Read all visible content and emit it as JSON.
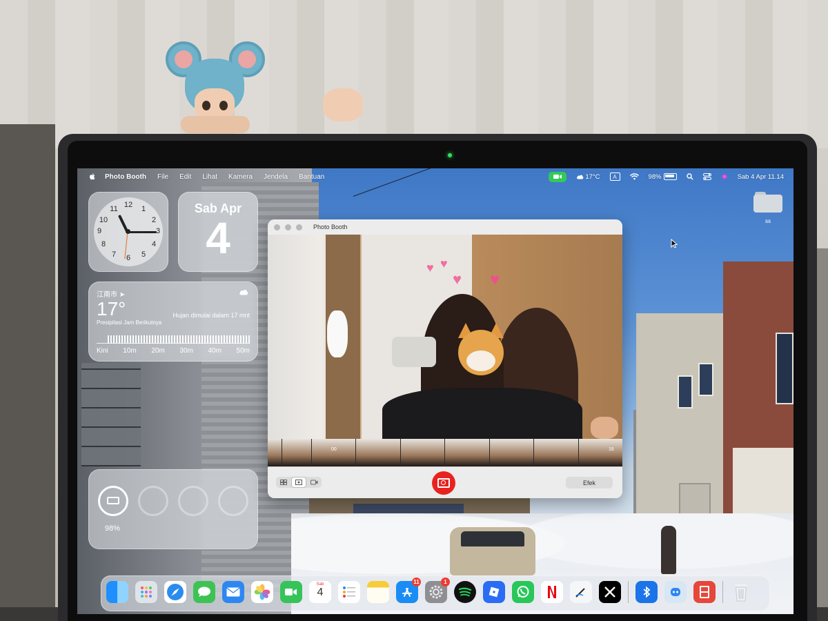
{
  "menubar": {
    "app_name": "Photo Booth",
    "items": [
      "File",
      "Edit",
      "Lihat",
      "Kamera",
      "Jendela",
      "Bantuan"
    ],
    "status": {
      "temperature": "17°C",
      "input_source": "A",
      "battery": "98%",
      "datetime": "Sab 4 Apr  11.14"
    }
  },
  "desktop": {
    "folder_label": "ss"
  },
  "widgets": {
    "clock": {
      "numbers": [
        "12",
        "1",
        "2",
        "3",
        "4",
        "5",
        "6",
        "7",
        "8",
        "9",
        "10",
        "11"
      ]
    },
    "date": {
      "top": "Sab Apr",
      "day": "4"
    },
    "weather": {
      "city": "江南市 ➤",
      "temperature": "17°",
      "description": "Hujan dimulai dalam 17 mnt",
      "subtitle": "Presipitasi Jam Berikutnya",
      "ticks": [
        "Kini",
        "10m",
        "20m",
        "30m",
        "40m",
        "50m"
      ]
    },
    "batteries": {
      "percent": "98%"
    }
  },
  "photobooth": {
    "window_title": "Photo Booth",
    "effects_button": "Efek",
    "strip_labels": {
      "duration": "00",
      "count": "16"
    }
  },
  "dock": {
    "calendar": {
      "month": "Sab",
      "day": "4"
    },
    "badges": {
      "app_store": "11",
      "settings": "1"
    }
  }
}
